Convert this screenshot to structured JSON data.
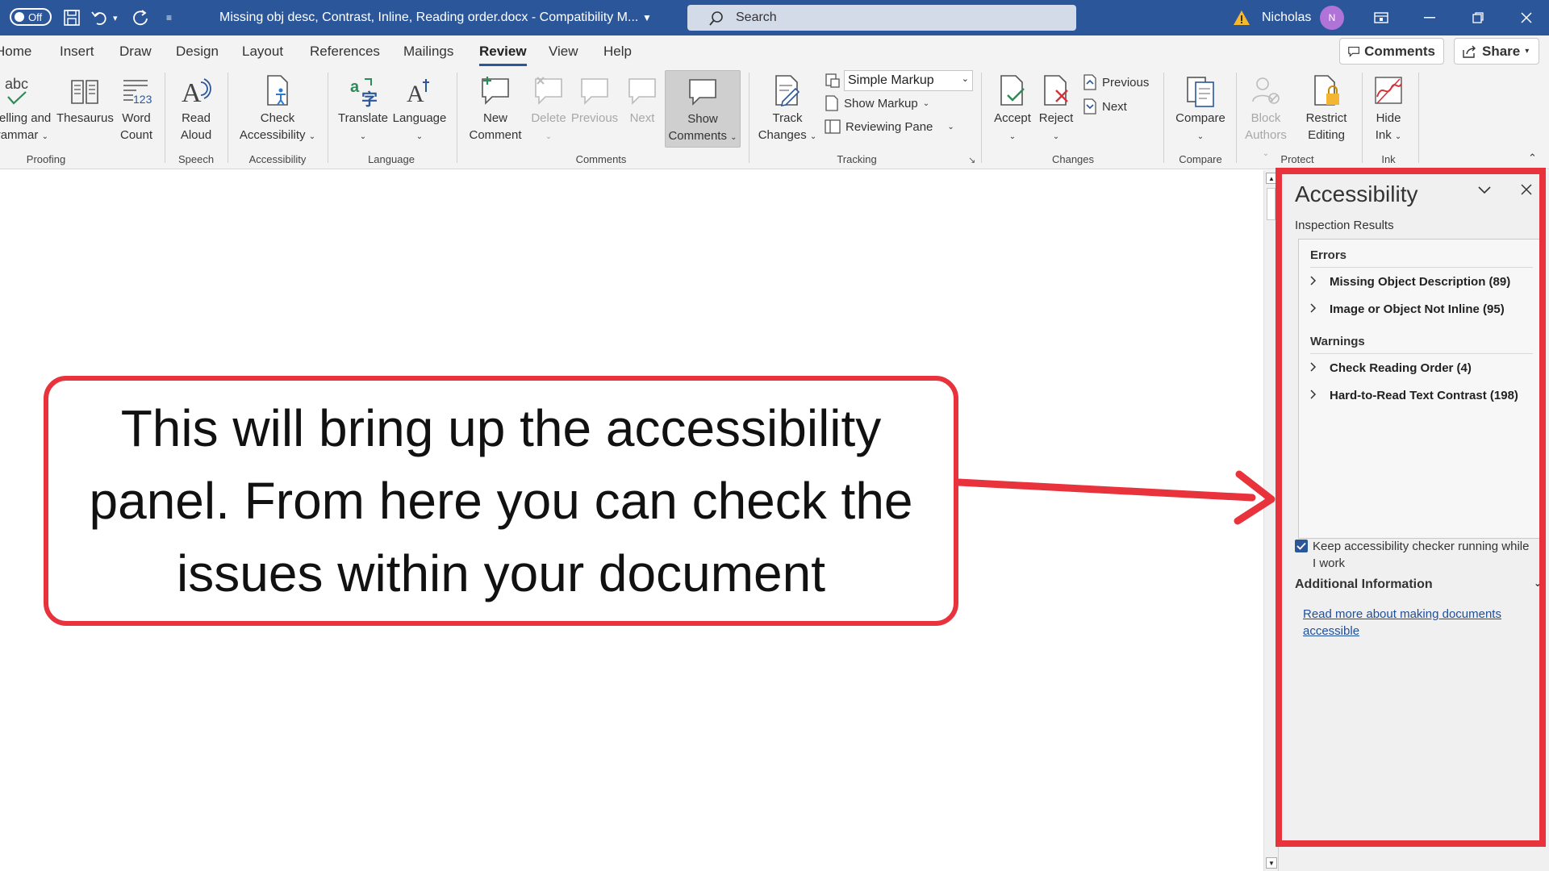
{
  "titlebar": {
    "autosave_state": "Off",
    "doc_title": "Missing obj desc, Contrast, Inline, Reading order.docx  -  Compatibility M...",
    "search_placeholder": "Search",
    "user_name": "Nicholas",
    "user_initial": "N"
  },
  "tabs": {
    "home": "Home",
    "insert": "Insert",
    "draw": "Draw",
    "design": "Design",
    "layout": "Layout",
    "references": "References",
    "mailings": "Mailings",
    "review": "Review",
    "view": "View",
    "help": "Help",
    "comments_btn": "Comments",
    "share_btn": "Share"
  },
  "ribbon": {
    "proofing": {
      "spelling_l1": "Spelling and",
      "spelling_l2": "Grammar",
      "thesaurus": "Thesaurus",
      "wordcount_l1": "Word",
      "wordcount_l2": "Count",
      "label": "Proofing"
    },
    "speech": {
      "read_l1": "Read",
      "read_l2": "Aloud",
      "label": "Speech"
    },
    "accessibility": {
      "check_l1": "Check",
      "check_l2": "Accessibility",
      "label": "Accessibility"
    },
    "language": {
      "translate": "Translate",
      "language": "Language",
      "label": "Language"
    },
    "comments": {
      "new_l1": "New",
      "new_l2": "Comment",
      "delete": "Delete",
      "previous": "Previous",
      "next": "Next",
      "show_l1": "Show",
      "show_l2": "Comments",
      "label": "Comments"
    },
    "tracking": {
      "track_l1": "Track",
      "track_l2": "Changes",
      "markup_mode": "Simple Markup",
      "show_markup": "Show Markup",
      "reviewing_pane": "Reviewing Pane",
      "label": "Tracking"
    },
    "changes": {
      "accept": "Accept",
      "reject": "Reject",
      "previous": "Previous",
      "next": "Next",
      "label": "Changes"
    },
    "compare": {
      "compare": "Compare",
      "label": "Compare"
    },
    "protect": {
      "block_l1": "Block",
      "block_l2": "Authors",
      "restrict_l1": "Restrict",
      "restrict_l2": "Editing",
      "label": "Protect"
    },
    "ink": {
      "hide_l1": "Hide",
      "hide_l2": "Ink",
      "label": "Ink"
    }
  },
  "pane": {
    "title": "Accessibility",
    "subtitle": "Inspection Results",
    "errors_head": "Errors",
    "errors": [
      "Missing Object Description (89)",
      "Image or Object Not Inline (95)"
    ],
    "warnings_head": "Warnings",
    "warnings": [
      "Check Reading Order (4)",
      "Hard-to-Read Text Contrast (198)"
    ],
    "keep_running": "Keep accessibility checker running while I work",
    "additional_info": "Additional Information",
    "read_more": "Read more about making documents accessible"
  },
  "callout": {
    "text": "This will bring up the accessibility panel. From here you can check the issues within your document"
  },
  "colors": {
    "title_bar": "#2b579a",
    "highlight_red": "#e8323c",
    "ribbon_bg": "#f3f3f3",
    "avatar": "#b073d8"
  }
}
